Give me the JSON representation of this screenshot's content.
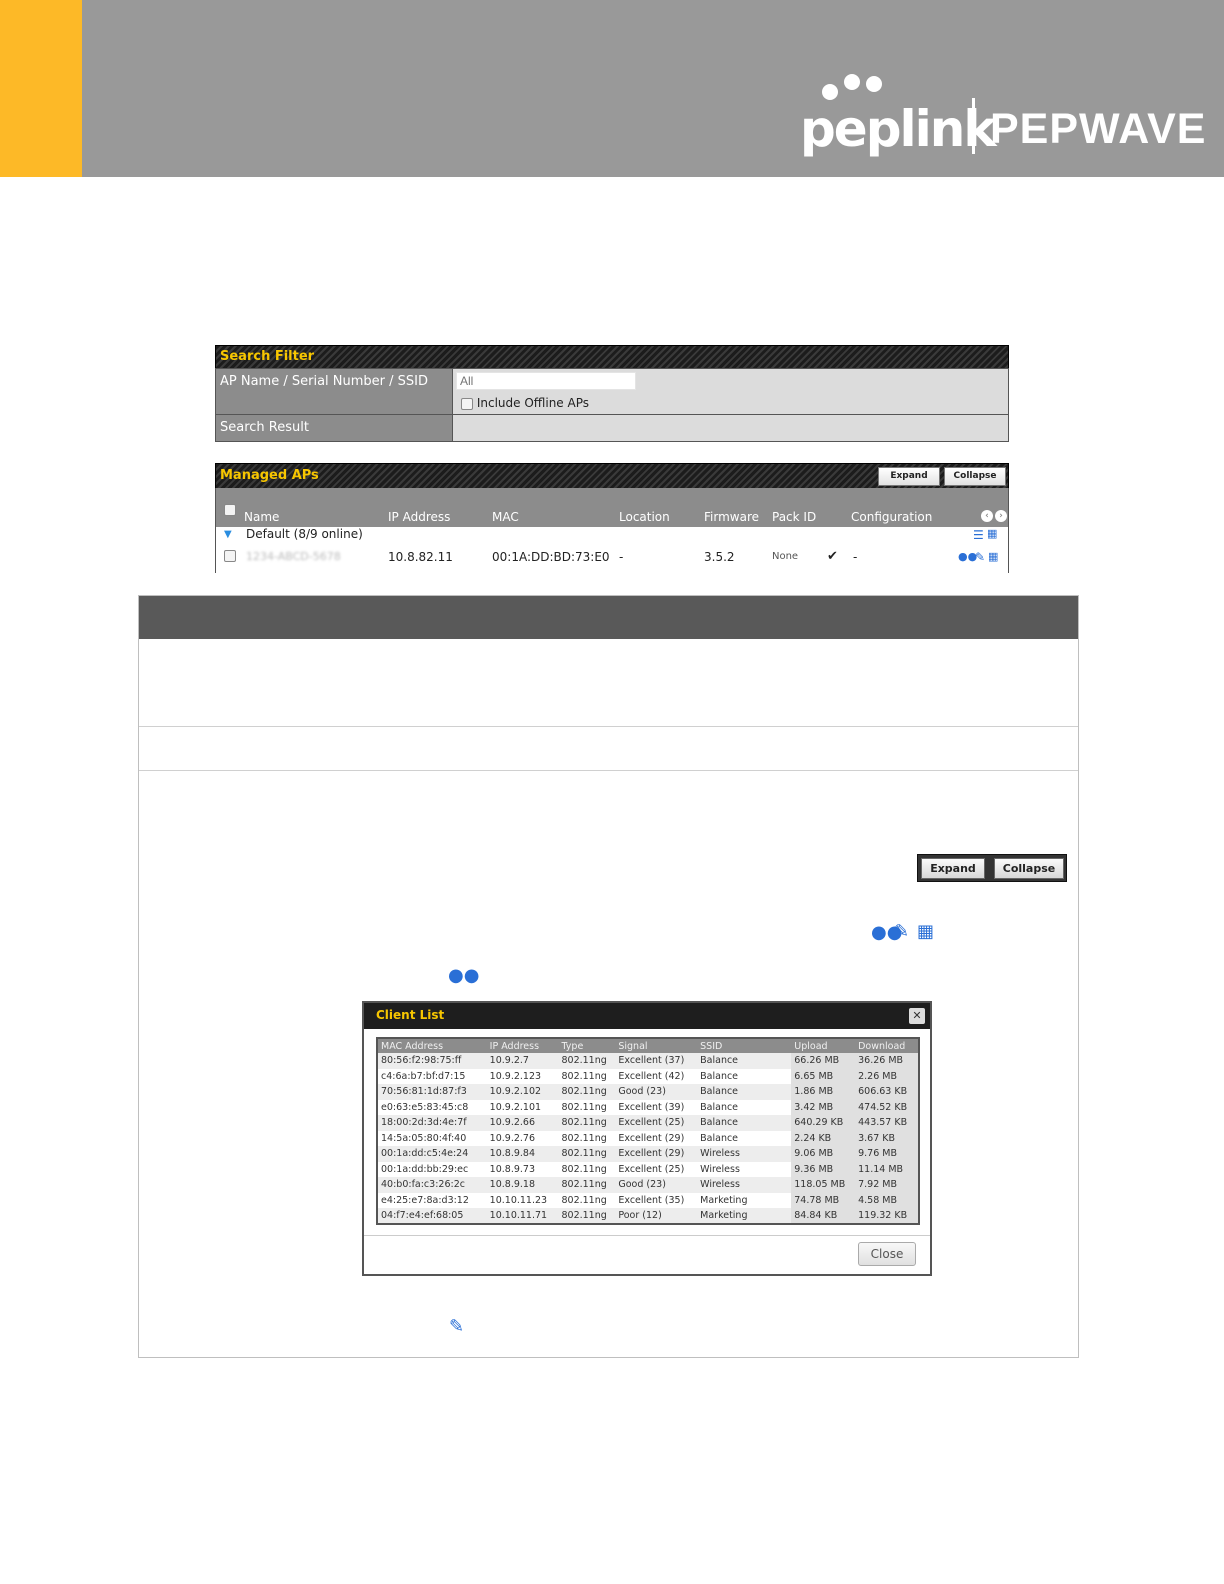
{
  "brand": {
    "primary_logo": "peplink",
    "secondary_logo": "PEPWAVE",
    "accent_color": "#fdb927",
    "header_color": "#999999"
  },
  "search_filter": {
    "title": "Search Filter",
    "name_label": "AP Name / Serial Number / SSID",
    "name_placeholder": "All",
    "include_offline_label": "Include Offline APs",
    "result_label": "Search Result"
  },
  "managed_aps": {
    "title": "Managed APs",
    "expand_label": "Expand",
    "collapse_label": "Collapse",
    "columns": [
      "Name",
      "IP Address",
      "MAC",
      "Location",
      "Firmware",
      "Pack ID",
      "Configuration"
    ],
    "group_label": "Default (8/9 online)",
    "device": {
      "name": "1234-ABCD-5678",
      "ip": "10.8.82.11",
      "mac": "00:1A:DD:BD:73:E0",
      "location": "-",
      "firmware": "3.5.2",
      "pack_id": "None",
      "configuration": "-"
    }
  },
  "page_table": {
    "expand_label": "Expand",
    "collapse_label": "Collapse",
    "icons": [
      "clients-icon",
      "edit-icon",
      "stats-icon"
    ]
  },
  "client_list": {
    "title": "Client List",
    "close_label": "Close",
    "columns": [
      "MAC Address",
      "IP Address",
      "Type",
      "Signal",
      "SSID",
      "Upload",
      "Download"
    ],
    "rows": [
      [
        "80:56:f2:98:75:ff",
        "10.9.2.7",
        "802.11ng",
        "Excellent (37)",
        "Balance",
        "66.26 MB",
        "36.26 MB"
      ],
      [
        "c4:6a:b7:bf:d7:15",
        "10.9.2.123",
        "802.11ng",
        "Excellent (42)",
        "Balance",
        "6.65 MB",
        "2.26 MB"
      ],
      [
        "70:56:81:1d:87:f3",
        "10.9.2.102",
        "802.11ng",
        "Good (23)",
        "Balance",
        "1.86 MB",
        "606.63 KB"
      ],
      [
        "e0:63:e5:83:45:c8",
        "10.9.2.101",
        "802.11ng",
        "Excellent (39)",
        "Balance",
        "3.42 MB",
        "474.52 KB"
      ],
      [
        "18:00:2d:3d:4e:7f",
        "10.9.2.66",
        "802.11ng",
        "Excellent (25)",
        "Balance",
        "640.29 KB",
        "443.57 KB"
      ],
      [
        "14:5a:05:80:4f:40",
        "10.9.2.76",
        "802.11ng",
        "Excellent (29)",
        "Balance",
        "2.24 KB",
        "3.67 KB"
      ],
      [
        "00:1a:dd:c5:4e:24",
        "10.8.9.84",
        "802.11ng",
        "Excellent (29)",
        "Wireless",
        "9.06 MB",
        "9.76 MB"
      ],
      [
        "00:1a:dd:bb:29:ec",
        "10.8.9.73",
        "802.11ng",
        "Excellent (25)",
        "Wireless",
        "9.36 MB",
        "11.14 MB"
      ],
      [
        "40:b0:fa:c3:26:2c",
        "10.8.9.18",
        "802.11ng",
        "Good (23)",
        "Wireless",
        "118.05 MB",
        "7.92 MB"
      ],
      [
        "e4:25:e7:8a:d3:12",
        "10.10.11.23",
        "802.11ng",
        "Excellent (35)",
        "Marketing",
        "74.78 MB",
        "4.58 MB"
      ],
      [
        "04:f7:e4:ef:68:05",
        "10.10.11.71",
        "802.11ng",
        "Poor (12)",
        "Marketing",
        "84.84 KB",
        "119.32 KB"
      ]
    ]
  }
}
